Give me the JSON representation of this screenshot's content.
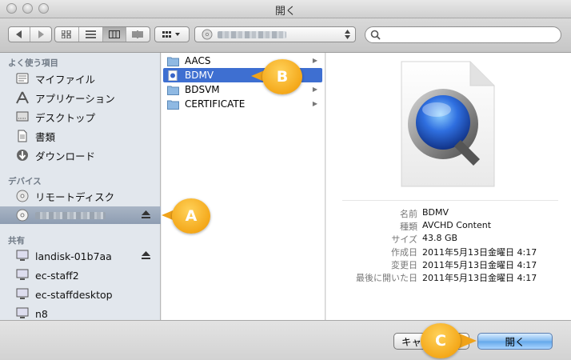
{
  "window": {
    "title": "開く"
  },
  "toolbar": {
    "back_icon": "chevron-left-icon",
    "forward_icon": "chevron-right-icon",
    "view_modes": [
      "icon-view-icon",
      "list-view-icon",
      "column-view-icon",
      "coverflow-view-icon"
    ],
    "arrange_icon": "arrange-grid-icon",
    "search_placeholder": ""
  },
  "sidebar": {
    "favorites_header": "よく使う項目",
    "favorites": [
      {
        "label": "マイファイル",
        "icon": "my-files-icon"
      },
      {
        "label": "アプリケーション",
        "icon": "applications-icon"
      },
      {
        "label": "デスクトップ",
        "icon": "desktop-icon"
      },
      {
        "label": "書類",
        "icon": "documents-icon"
      },
      {
        "label": "ダウンロード",
        "icon": "downloads-icon"
      }
    ],
    "devices_header": "デバイス",
    "devices": [
      {
        "label": "リモートディスク",
        "icon": "remote-disc-icon"
      }
    ],
    "shared_header": "共有",
    "shared": [
      {
        "label": "landisk-01b7aa",
        "icon": "network-computer-icon",
        "eject": true
      },
      {
        "label": "ec-staff2",
        "icon": "network-computer-icon"
      },
      {
        "label": "ec-staffdesktop",
        "icon": "network-computer-icon"
      },
      {
        "label": "n8",
        "icon": "network-computer-icon"
      }
    ]
  },
  "columns": {
    "items": [
      {
        "label": "AACS"
      },
      {
        "label": "BDMV",
        "selected": true
      },
      {
        "label": "BDSVM"
      },
      {
        "label": "CERTIFICATE"
      }
    ]
  },
  "preview": {
    "icon": "quicktime-file-icon",
    "info": [
      {
        "key": "名前",
        "value": "BDMV"
      },
      {
        "key": "種類",
        "value": "AVCHD Content"
      },
      {
        "key": "サイズ",
        "value": "43.8 GB"
      },
      {
        "key": "作成日",
        "value": "2011年5月13日金曜日 4:17"
      },
      {
        "key": "変更日",
        "value": "2011年5月13日金曜日 4:17"
      },
      {
        "key": "最後に開いた日",
        "value": "2011年5月13日金曜日 4:17"
      }
    ]
  },
  "buttons": {
    "cancel": "キャ",
    "open": "開く"
  },
  "callouts": {
    "a": "A",
    "b": "B",
    "c": "C",
    "color": "#f4a81a"
  }
}
